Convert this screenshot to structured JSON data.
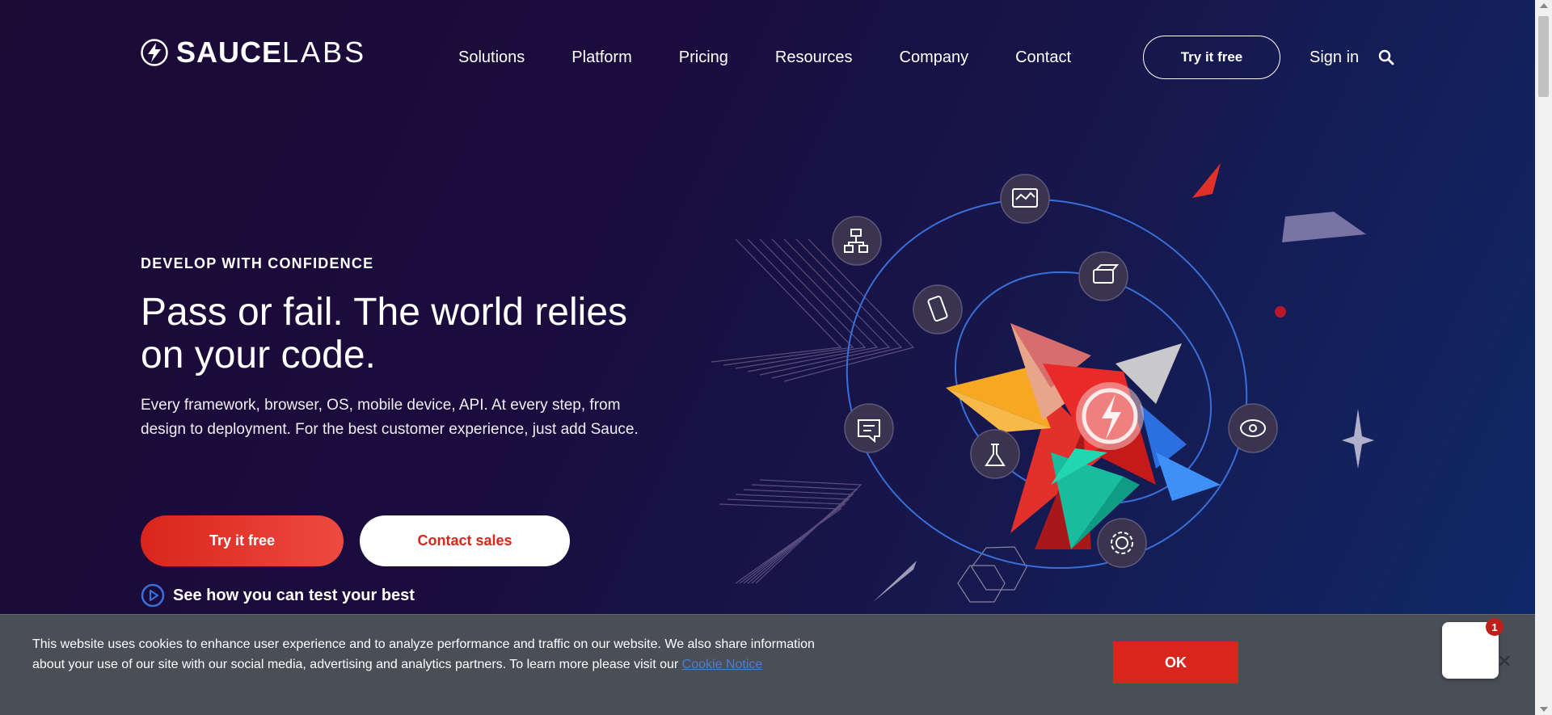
{
  "header": {
    "logo_bold": "SAUCE",
    "logo_light": "LABS",
    "nav": [
      "Solutions",
      "Platform",
      "Pricing",
      "Resources",
      "Company",
      "Contact"
    ],
    "try_free": "Try it free",
    "sign_in": "Sign in"
  },
  "hero": {
    "eyebrow": "DEVELOP WITH CONFIDENCE",
    "headline": "Pass or fail. The world relies on your code.",
    "subtext": "Every framework, browser, OS, mobile device, API. At every step, from design to deployment. For the best customer experience, just add Sauce.",
    "primary_cta": "Try it free",
    "secondary_cta": "Contact sales",
    "video_link": "See how you can test your best"
  },
  "cookie": {
    "text": "This website uses cookies to enhance user experience and to analyze performance and traffic on our website. We also share information about your use of our site with our social media, advertising and analytics partners. To learn more please visit our ",
    "link": "Cookie Notice",
    "ok": "OK",
    "close": "✕"
  },
  "chat": {
    "badge": "1"
  },
  "colors": {
    "accent_red": "#d9261c",
    "bg_dark": "#1c0a35",
    "bg_blue": "#0f2a6b",
    "orbit_blue": "#3a6fd8"
  }
}
